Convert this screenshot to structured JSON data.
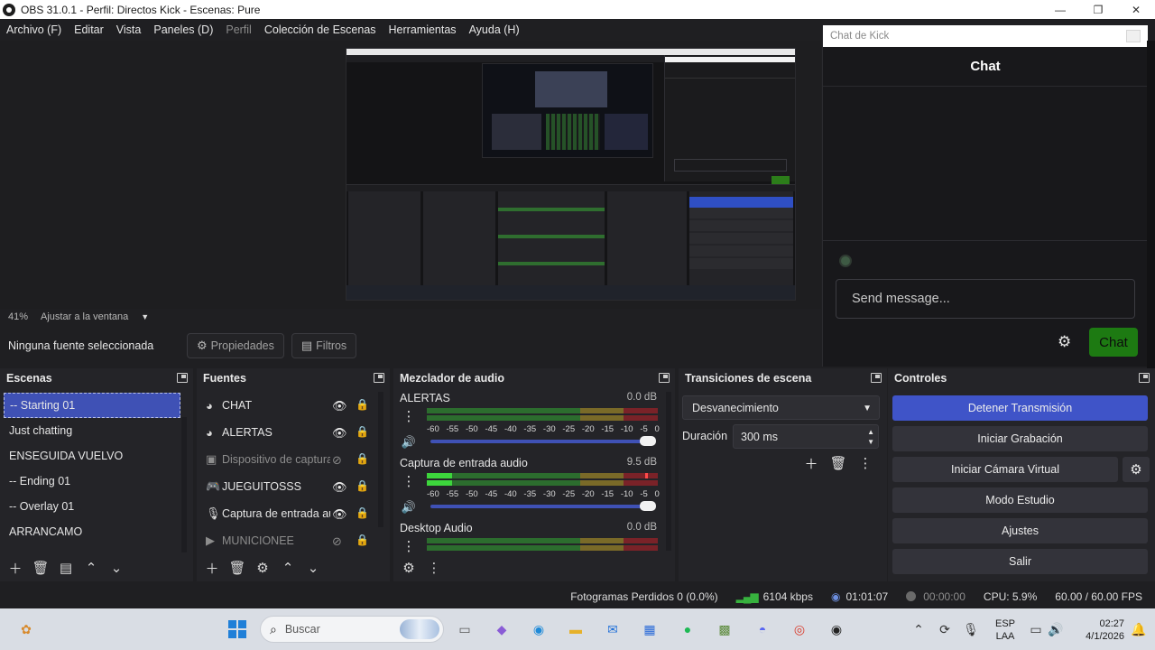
{
  "window": {
    "title": "OBS 31.0.1 - Perfil: Directos Kick - Escenas: Pure"
  },
  "menu": {
    "items": [
      "Archivo (F)",
      "Editar",
      "Vista",
      "Paneles (D)",
      "Perfil",
      "Colección de Escenas",
      "Herramientas",
      "Ayuda (H)"
    ]
  },
  "preview": {
    "zoom": "41%",
    "zoom_mode": "Ajustar a la ventana"
  },
  "source_toolbar": {
    "no_source": "Ninguna fuente seleccionada",
    "properties": "Propiedades",
    "filters": "Filtros"
  },
  "chat": {
    "window_title": "Chat de Kick",
    "header": "Chat",
    "input_placeholder": "Send message...",
    "send_label": "Chat",
    "send_color": "#1d7a12"
  },
  "scenes": {
    "title": "Escenas",
    "items": [
      "-- Starting 01",
      "Just chatting",
      "ENSEGUIDA VUELVO",
      "-- Ending 01",
      "-- Overlay 01",
      "ARRANCAMO"
    ],
    "selected_index": 0
  },
  "sources": {
    "title": "Fuentes",
    "items": [
      {
        "name": "CHAT",
        "icon": "browser-icon",
        "visible": true
      },
      {
        "name": "ALERTAS",
        "icon": "browser-icon",
        "visible": true
      },
      {
        "name": "Dispositivo de captura de vídeo",
        "icon": "camera-icon",
        "visible": false
      },
      {
        "name": "JUEGUITOSSS",
        "icon": "gamepad-icon",
        "visible": true
      },
      {
        "name": "Captura de entrada audio",
        "icon": "microphone-icon",
        "visible": true
      },
      {
        "name": "MUNICIONEE",
        "icon": "play-icon",
        "visible": false
      }
    ]
  },
  "mixer": {
    "title": "Mezclador de audio",
    "ticks": [
      "-60",
      "-55",
      "-50",
      "-45",
      "-40",
      "-35",
      "-30",
      "-25",
      "-20",
      "-15",
      "-10",
      "-5",
      "0"
    ],
    "channels": [
      {
        "name": "ALERTAS",
        "db": "0.0 dB",
        "volume": 1.0
      },
      {
        "name": "Captura de entrada audio",
        "db": "9.5 dB",
        "volume": 1.0
      },
      {
        "name": "Desktop Audio",
        "db": "0.0 dB",
        "volume": 1.0
      }
    ]
  },
  "transitions": {
    "title": "Transiciones de escena",
    "selected": "Desvanecimiento",
    "duration_label": "Duración",
    "duration_value": "300 ms"
  },
  "controls": {
    "title": "Controles",
    "buttons": [
      "Detener Transmisión",
      "Iniciar Grabación",
      "Iniciar Cámara Virtual",
      "Modo Estudio",
      "Ajustes",
      "Salir"
    ],
    "accent": "#3f54c8"
  },
  "status": {
    "dropped_frames": "Fotogramas Perdidos 0 (0.0%)",
    "bitrate": "6104 kbps",
    "stream_time": "01:01:07",
    "rec_time": "00:00:00",
    "cpu": "CPU: 5.9%",
    "fps": "60.00 / 60.00 FPS"
  },
  "taskbar": {
    "search_placeholder": "Buscar",
    "language_1": "ESP",
    "language_2": "LAA",
    "time": "02:27",
    "date": "4/1/2026"
  }
}
